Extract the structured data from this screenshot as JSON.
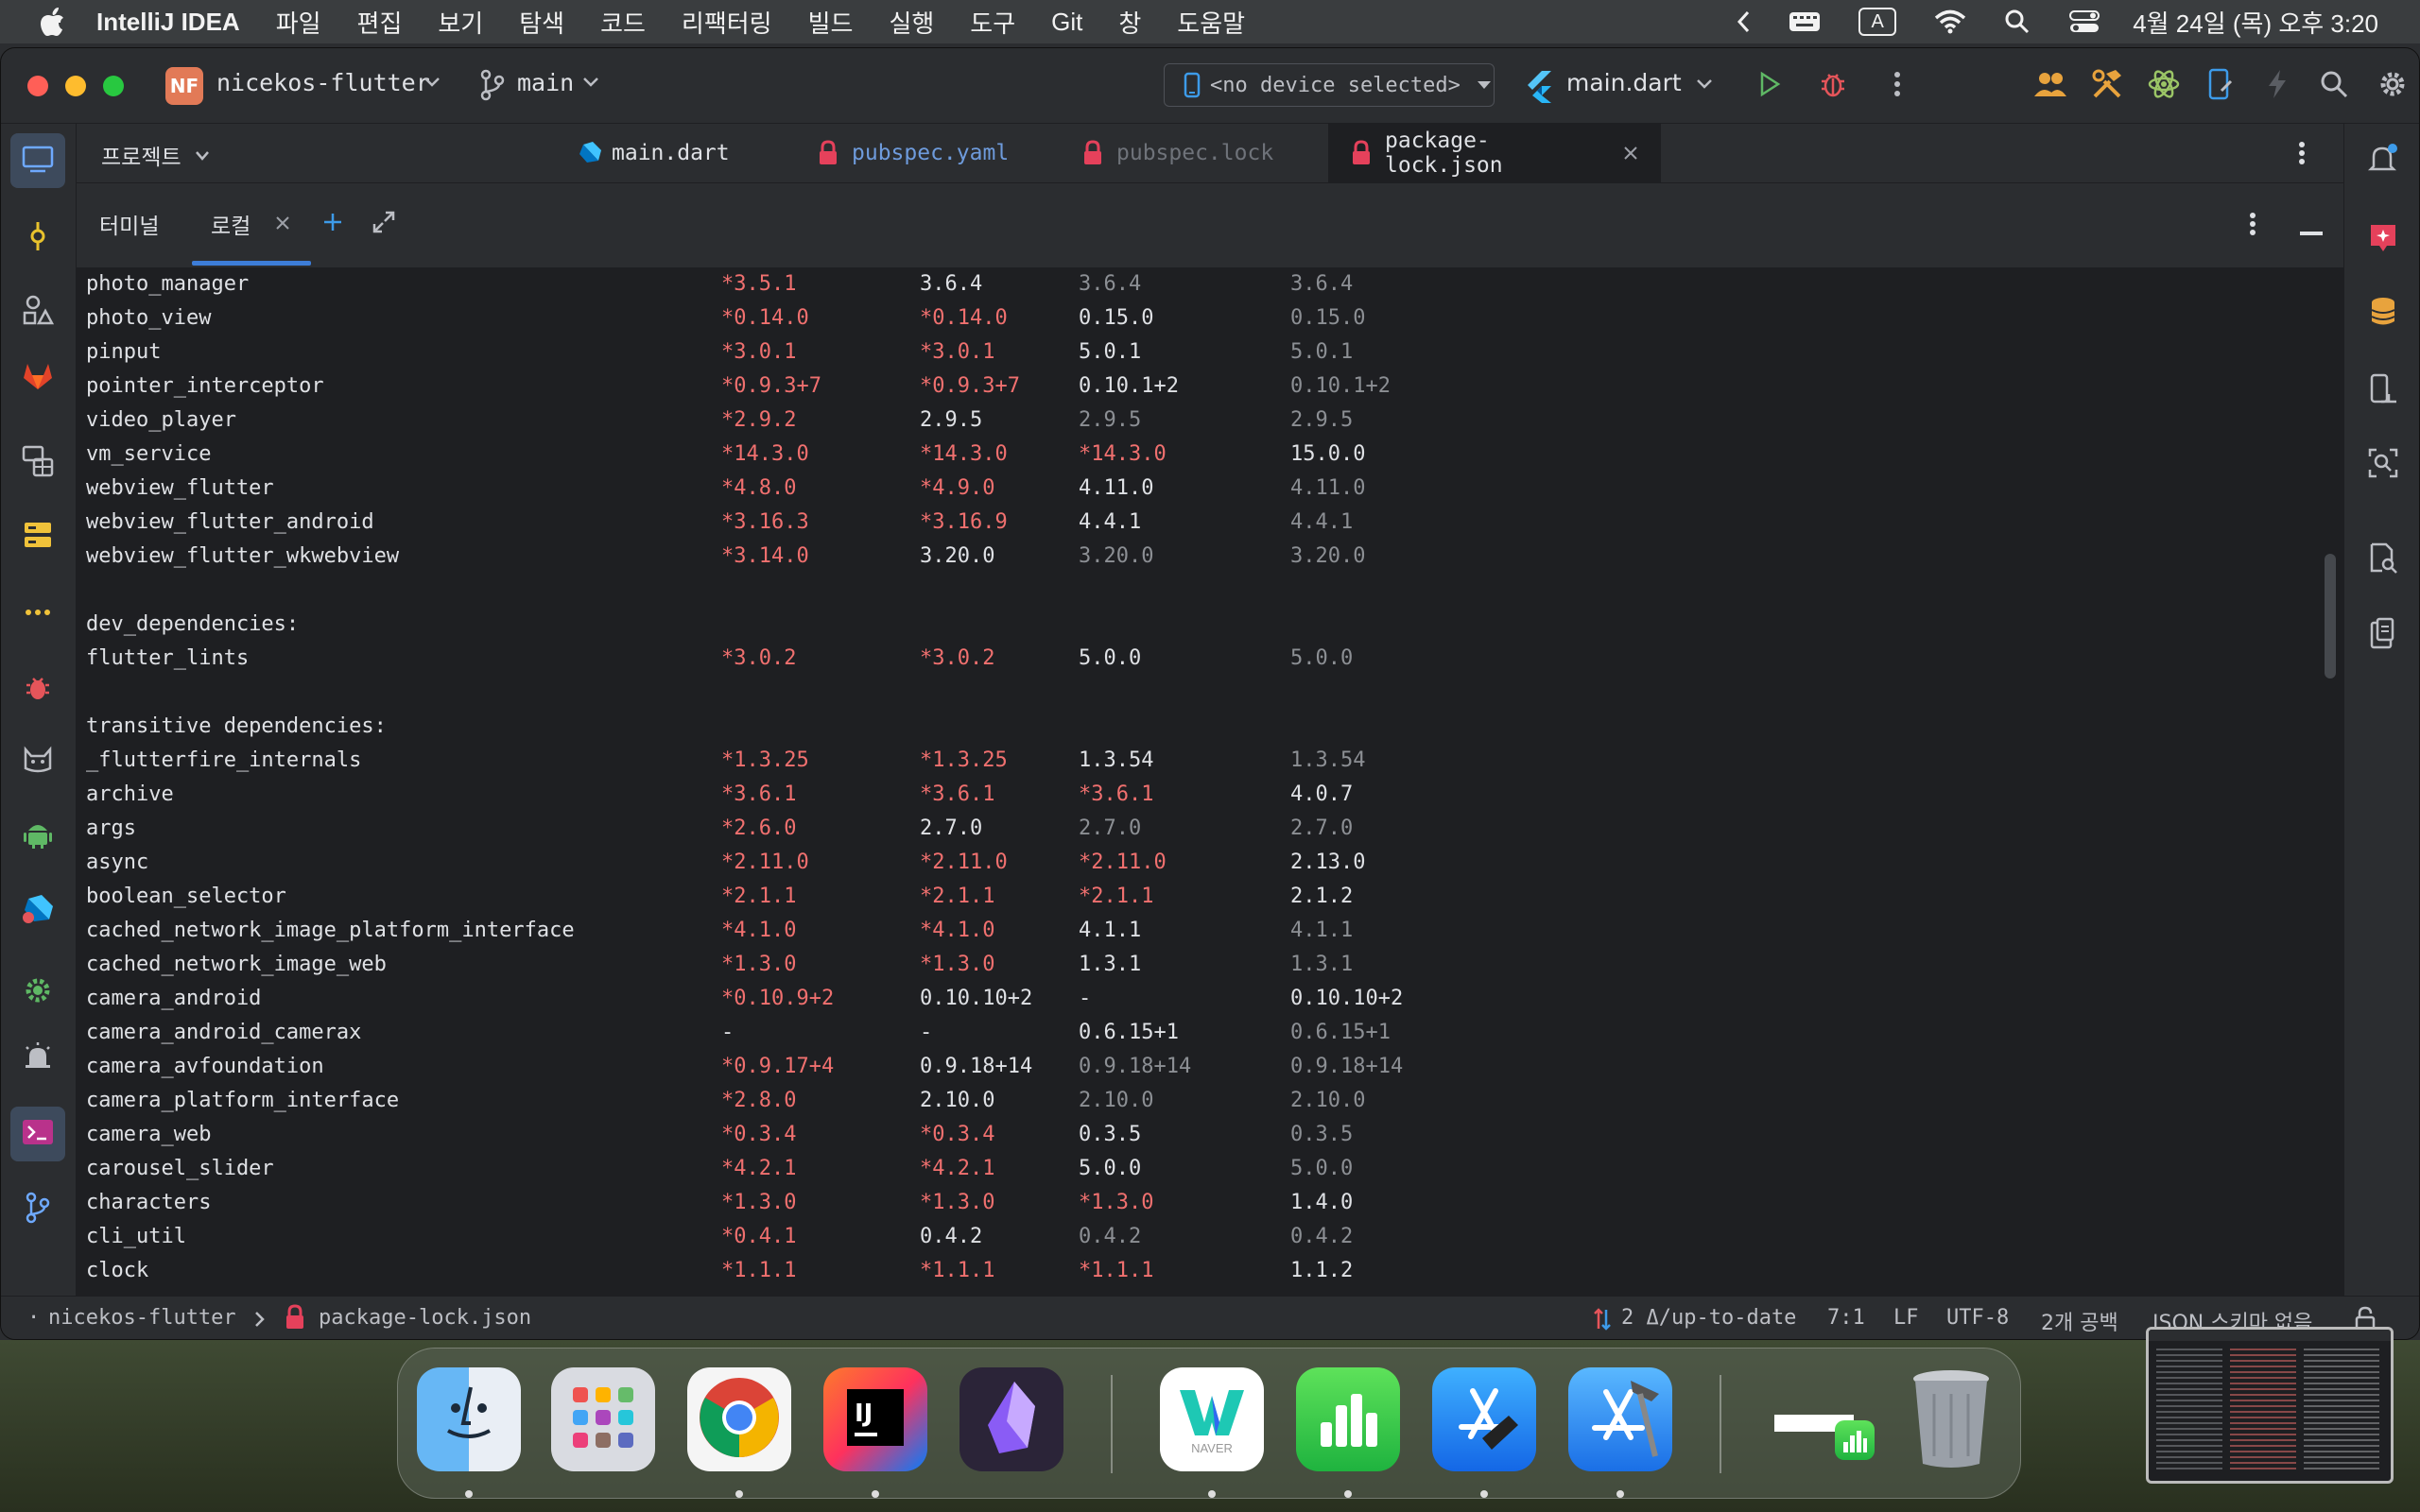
{
  "menubar": {
    "app_name": "IntelliJ IDEA",
    "items": [
      "파일",
      "편집",
      "보기",
      "탐색",
      "코드",
      "리팩터링",
      "빌드",
      "실행",
      "도구",
      "Git",
      "창",
      "도움말"
    ],
    "input_indicator": "A",
    "datetime": "4월 24일 (목) 오후 3:20"
  },
  "titlebar": {
    "project_badge": "NF",
    "project_name": "nicekos-flutter",
    "branch": "main",
    "device": "<no device selected>",
    "run_config": "main.dart"
  },
  "project_panel": {
    "label": "프로젝트"
  },
  "editor_tabs": [
    {
      "label": "main.dart",
      "color": "#dfe1e5"
    },
    {
      "label": "pubspec.yaml",
      "color": "#6e9bdc"
    },
    {
      "label": "pubspec.lock",
      "color": "#6f737a"
    },
    {
      "label": "package-lock.json",
      "color": "#dfe1e5"
    }
  ],
  "terminal_header": {
    "tab_terminal": "터미널",
    "tab_local": "로컬"
  },
  "terminal_rows": [
    {
      "name": "photo_manager",
      "c": [
        [
          "*3.5.1",
          "r"
        ],
        [
          "3.6.4",
          "w"
        ],
        [
          "3.6.4",
          "g"
        ],
        [
          "3.6.4",
          "g"
        ]
      ]
    },
    {
      "name": "photo_view",
      "c": [
        [
          "*0.14.0",
          "r"
        ],
        [
          "*0.14.0",
          "r"
        ],
        [
          "0.15.0",
          "w"
        ],
        [
          "0.15.0",
          "g"
        ]
      ]
    },
    {
      "name": "pinput",
      "c": [
        [
          "*3.0.1",
          "r"
        ],
        [
          "*3.0.1",
          "r"
        ],
        [
          "5.0.1",
          "w"
        ],
        [
          "5.0.1",
          "g"
        ]
      ]
    },
    {
      "name": "pointer_interceptor",
      "c": [
        [
          "*0.9.3+7",
          "r"
        ],
        [
          "*0.9.3+7",
          "r"
        ],
        [
          "0.10.1+2",
          "w"
        ],
        [
          "0.10.1+2",
          "g"
        ]
      ]
    },
    {
      "name": "video_player",
      "c": [
        [
          "*2.9.2",
          "r"
        ],
        [
          "2.9.5",
          "w"
        ],
        [
          "2.9.5",
          "g"
        ],
        [
          "2.9.5",
          "g"
        ]
      ]
    },
    {
      "name": "vm_service",
      "c": [
        [
          "*14.3.0",
          "r"
        ],
        [
          "*14.3.0",
          "r"
        ],
        [
          "*14.3.0",
          "r"
        ],
        [
          "15.0.0",
          "w"
        ]
      ]
    },
    {
      "name": "webview_flutter",
      "c": [
        [
          "*4.8.0",
          "r"
        ],
        [
          "*4.9.0",
          "r"
        ],
        [
          "4.11.0",
          "w"
        ],
        [
          "4.11.0",
          "g"
        ]
      ]
    },
    {
      "name": "webview_flutter_android",
      "c": [
        [
          "*3.16.3",
          "r"
        ],
        [
          "*3.16.9",
          "r"
        ],
        [
          "4.4.1",
          "w"
        ],
        [
          "4.4.1",
          "g"
        ]
      ]
    },
    {
      "name": "webview_flutter_wkwebview",
      "c": [
        [
          "*3.14.0",
          "r"
        ],
        [
          "3.20.0",
          "w"
        ],
        [
          "3.20.0",
          "g"
        ],
        [
          "3.20.0",
          "g"
        ]
      ]
    },
    {
      "name": "",
      "c": []
    },
    {
      "name": "dev_dependencies:",
      "c": []
    },
    {
      "name": "flutter_lints",
      "c": [
        [
          "*3.0.2",
          "r"
        ],
        [
          "*3.0.2",
          "r"
        ],
        [
          "5.0.0",
          "w"
        ],
        [
          "5.0.0",
          "g"
        ]
      ]
    },
    {
      "name": "",
      "c": []
    },
    {
      "name": "transitive dependencies:",
      "c": []
    },
    {
      "name": "_flutterfire_internals",
      "c": [
        [
          "*1.3.25",
          "r"
        ],
        [
          "*1.3.25",
          "r"
        ],
        [
          "1.3.54",
          "w"
        ],
        [
          "1.3.54",
          "g"
        ]
      ]
    },
    {
      "name": "archive",
      "c": [
        [
          "*3.6.1",
          "r"
        ],
        [
          "*3.6.1",
          "r"
        ],
        [
          "*3.6.1",
          "r"
        ],
        [
          "4.0.7",
          "w"
        ]
      ]
    },
    {
      "name": "args",
      "c": [
        [
          "*2.6.0",
          "r"
        ],
        [
          "2.7.0",
          "w"
        ],
        [
          "2.7.0",
          "g"
        ],
        [
          "2.7.0",
          "g"
        ]
      ]
    },
    {
      "name": "async",
      "c": [
        [
          "*2.11.0",
          "r"
        ],
        [
          "*2.11.0",
          "r"
        ],
        [
          "*2.11.0",
          "r"
        ],
        [
          "2.13.0",
          "w"
        ]
      ]
    },
    {
      "name": "boolean_selector",
      "c": [
        [
          "*2.1.1",
          "r"
        ],
        [
          "*2.1.1",
          "r"
        ],
        [
          "*2.1.1",
          "r"
        ],
        [
          "2.1.2",
          "w"
        ]
      ]
    },
    {
      "name": "cached_network_image_platform_interface",
      "c": [
        [
          "*4.1.0",
          "r"
        ],
        [
          "*4.1.0",
          "r"
        ],
        [
          "4.1.1",
          "w"
        ],
        [
          "4.1.1",
          "g"
        ]
      ]
    },
    {
      "name": "cached_network_image_web",
      "c": [
        [
          "*1.3.0",
          "r"
        ],
        [
          "*1.3.0",
          "r"
        ],
        [
          "1.3.1",
          "w"
        ],
        [
          "1.3.1",
          "g"
        ]
      ]
    },
    {
      "name": "camera_android",
      "c": [
        [
          "*0.10.9+2",
          "r"
        ],
        [
          "0.10.10+2",
          "w"
        ],
        [
          "-",
          "w"
        ],
        [
          "0.10.10+2",
          "w"
        ]
      ]
    },
    {
      "name": "camera_android_camerax",
      "c": [
        [
          "-",
          "w"
        ],
        [
          "-",
          "w"
        ],
        [
          "0.6.15+1",
          "w"
        ],
        [
          "0.6.15+1",
          "g"
        ]
      ]
    },
    {
      "name": "camera_avfoundation",
      "c": [
        [
          "*0.9.17+4",
          "r"
        ],
        [
          "0.9.18+14",
          "w"
        ],
        [
          "0.9.18+14",
          "g"
        ],
        [
          "0.9.18+14",
          "g"
        ]
      ]
    },
    {
      "name": "camera_platform_interface",
      "c": [
        [
          "*2.8.0",
          "r"
        ],
        [
          "2.10.0",
          "w"
        ],
        [
          "2.10.0",
          "g"
        ],
        [
          "2.10.0",
          "g"
        ]
      ]
    },
    {
      "name": "camera_web",
      "c": [
        [
          "*0.3.4",
          "r"
        ],
        [
          "*0.3.4",
          "r"
        ],
        [
          "0.3.5",
          "w"
        ],
        [
          "0.3.5",
          "g"
        ]
      ]
    },
    {
      "name": "carousel_slider",
      "c": [
        [
          "*4.2.1",
          "r"
        ],
        [
          "*4.2.1",
          "r"
        ],
        [
          "5.0.0",
          "w"
        ],
        [
          "5.0.0",
          "g"
        ]
      ]
    },
    {
      "name": "characters",
      "c": [
        [
          "*1.3.0",
          "r"
        ],
        [
          "*1.3.0",
          "r"
        ],
        [
          "*1.3.0",
          "r"
        ],
        [
          "1.4.0",
          "w"
        ]
      ]
    },
    {
      "name": "cli_util",
      "c": [
        [
          "*0.4.1",
          "r"
        ],
        [
          "0.4.2",
          "w"
        ],
        [
          "0.4.2",
          "g"
        ],
        [
          "0.4.2",
          "g"
        ]
      ]
    },
    {
      "name": "clock",
      "c": [
        [
          "*1.1.1",
          "r"
        ],
        [
          "*1.1.1",
          "r"
        ],
        [
          "*1.1.1",
          "r"
        ],
        [
          "1.1.2",
          "w"
        ]
      ]
    }
  ],
  "statusbar": {
    "project": "nicekos-flutter",
    "file": "package-lock.json",
    "vcs": "2 Δ/up-to-date",
    "position": "7:1",
    "line_sep": "LF",
    "encoding": "UTF-8",
    "indent": "2개 공백",
    "schema": "JSON 스키마 없음"
  },
  "dock": {
    "apps": [
      "finder",
      "launchpad",
      "chrome",
      "intellij",
      "obsidian",
      "naver-whale",
      "numbers",
      "app-store-connect",
      "xcode"
    ],
    "naver_label": "NAVER"
  }
}
